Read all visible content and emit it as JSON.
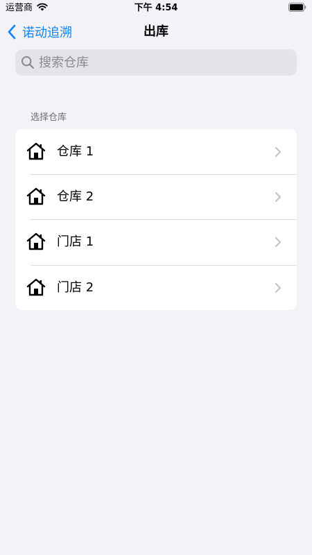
{
  "status_bar": {
    "carrier": "运营商",
    "time": "下午 4:54",
    "wifi_icon": "wifi-icon",
    "battery_icon": "battery-icon"
  },
  "nav": {
    "back_label": "诺动追溯",
    "back_icon": "chevron-left-icon",
    "title": "出库"
  },
  "search": {
    "placeholder": "搜索仓库",
    "value": "",
    "icon": "search-icon"
  },
  "section": {
    "header": "选择仓库",
    "items": [
      {
        "label": "仓库 1",
        "icon": "house-icon"
      },
      {
        "label": "仓库 2",
        "icon": "house-icon"
      },
      {
        "label": "门店 1",
        "icon": "house-icon"
      },
      {
        "label": "门店 2",
        "icon": "house-icon"
      }
    ]
  },
  "colors": {
    "accent": "#0a84ff",
    "background": "#f2f2f7",
    "search_bg": "#e3e3e8",
    "secondary_text": "#6d6d72",
    "chevron": "#c4c4c7"
  }
}
